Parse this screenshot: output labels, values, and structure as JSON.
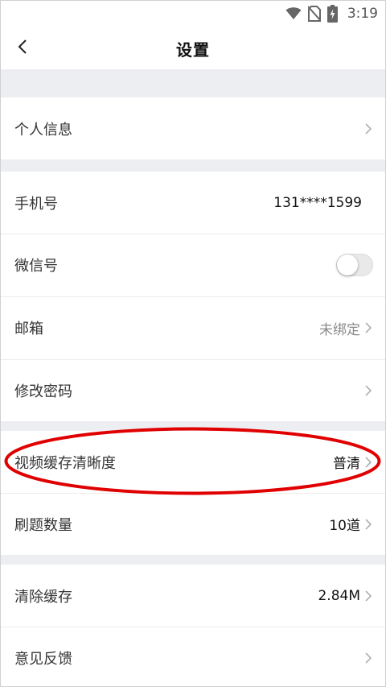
{
  "status_bar": {
    "time": "3:19",
    "icons": [
      "wifi-icon",
      "no-sim-icon",
      "battery-charging-icon"
    ]
  },
  "header": {
    "title": "设置",
    "back_icon": "chevron-left-icon"
  },
  "sections": [
    {
      "rows": [
        {
          "id": "personal-info",
          "label": "个人信息",
          "value": "",
          "chevron": true
        }
      ]
    },
    {
      "rows": [
        {
          "id": "phone",
          "label": "手机号",
          "value": "131****1599",
          "chevron": false
        },
        {
          "id": "wechat",
          "label": "微信号",
          "toggle": false
        },
        {
          "id": "email",
          "label": "邮箱",
          "value": "未绑定",
          "chevron": true
        },
        {
          "id": "change-password",
          "label": "修改密码",
          "value": "",
          "chevron": true
        }
      ]
    },
    {
      "rows": [
        {
          "id": "video-cache-quality",
          "label": "视频缓存清晰度",
          "value": "普清",
          "chevron": true
        },
        {
          "id": "question-count",
          "label": "刷题数量",
          "value": "10道",
          "chevron": true
        }
      ]
    },
    {
      "rows": [
        {
          "id": "clear-cache",
          "label": "清除缓存",
          "value": "2.84M",
          "chevron": true
        },
        {
          "id": "feedback",
          "label": "意见反馈",
          "value": "",
          "chevron": true
        }
      ]
    }
  ],
  "colors": {
    "background": "#f2f3f5",
    "row_background": "#ffffff",
    "annotation": "#e00000",
    "chevron": "#b0b0b0"
  }
}
